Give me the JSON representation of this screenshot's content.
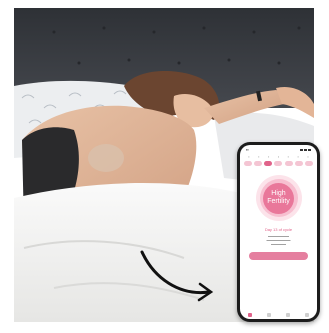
{
  "phone": {
    "badge_line1": "High",
    "badge_line2": "Fertility",
    "day_label": "Day 13 of cycle"
  },
  "colors": {
    "accent": "#e0638a",
    "headboard": "#3a3d42",
    "sheets": "#f3f3f1"
  }
}
